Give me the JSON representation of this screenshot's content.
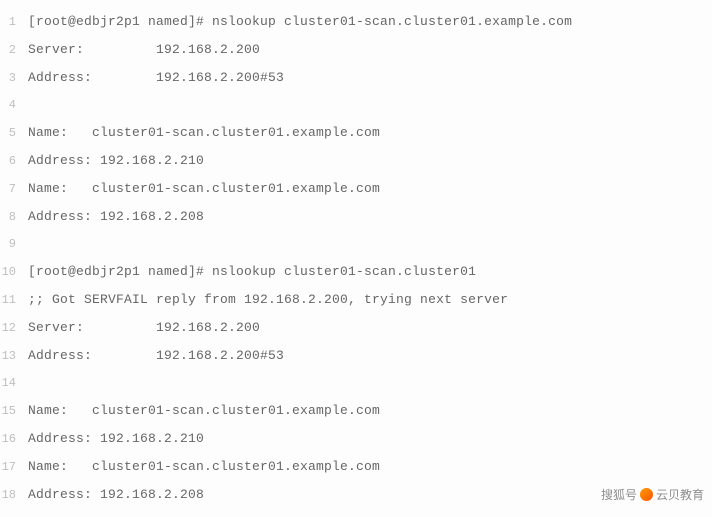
{
  "lines": [
    "[root@edbjr2p1 named]# nslookup cluster01-scan.cluster01.example.com",
    "Server:         192.168.2.200",
    "Address:        192.168.2.200#53",
    "",
    "Name:   cluster01-scan.cluster01.example.com",
    "Address: 192.168.2.210",
    "Name:   cluster01-scan.cluster01.example.com",
    "Address: 192.168.2.208",
    "",
    "[root@edbjr2p1 named]# nslookup cluster01-scan.cluster01",
    ";; Got SERVFAIL reply from 192.168.2.200, trying next server",
    "Server:         192.168.2.200",
    "Address:        192.168.2.200#53",
    "",
    "Name:   cluster01-scan.cluster01.example.com",
    "Address: 192.168.2.210",
    "Name:   cluster01-scan.cluster01.example.com",
    "Address: 192.168.2.208"
  ],
  "watermark": {
    "left": "搜狐号",
    "right": "云贝教育"
  }
}
